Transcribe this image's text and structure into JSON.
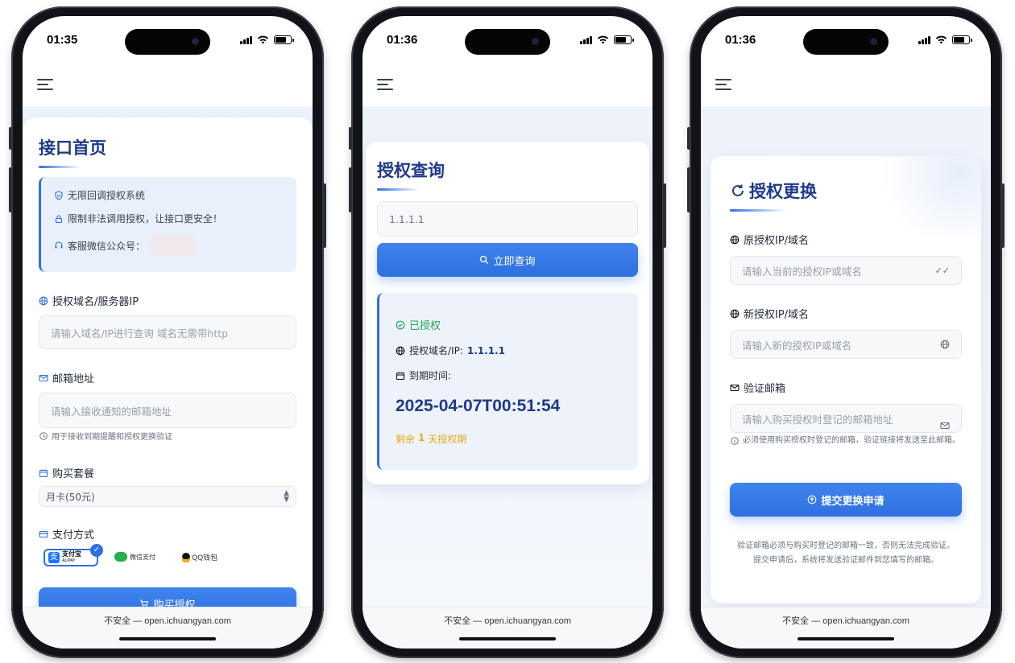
{
  "phones": [
    {
      "time": "01:35",
      "url": "不安全 — open.ichuangyan.com",
      "title": "接口首页",
      "notice": [
        "无限回调授权系统",
        "限制非法调用授权，让接口更安全！",
        "客服微信公众号："
      ],
      "domain_label": "授权域名/服务器IP",
      "domain_placeholder": "请输入域名/IP进行查询 域名无需带http",
      "email_label": "邮箱地址",
      "email_placeholder": "请输入接收通知的邮箱地址",
      "email_hint": "用于接收到期提醒和授权更换验证",
      "plan_label": "购买套餐",
      "plan_value": "月卡(50元)",
      "pay_label": "支付方式",
      "pay_options": [
        "支付宝",
        "微信支付",
        "QQ钱包"
      ],
      "alipay_en": "ALIPAY",
      "buy_button": "购买授权"
    },
    {
      "time": "01:36",
      "url": "不安全 — open.ichuangyan.com",
      "title": "授权查询",
      "query_value": "1.1.1.1",
      "query_button": "立即查询",
      "status": "已授权",
      "domain_label": "授权域名/IP:",
      "domain_value": "1.1.1.1",
      "expire_label": "到期时间:",
      "expire_value": "2025-04-07T00:51:54",
      "remain_prefix": "剩余",
      "remain_days": "1",
      "remain_suffix": "天授权期"
    },
    {
      "time": "01:36",
      "url": "不安全 — open.ichuangyan.com",
      "title": "授权更换",
      "old_label": "原授权IP/域名",
      "old_placeholder": "请输入当前的授权IP或域名",
      "new_label": "新授权IP/域名",
      "new_placeholder": "请输入新的授权IP或域名",
      "verify_label": "验证邮箱",
      "verify_placeholder": "请输入购买授权时登记的邮箱地址",
      "verify_hint": "必须使用购买授权时登记的邮箱，验证链接将发送至此邮箱。",
      "submit_button": "提交更换申请",
      "footer_note_1": "验证邮箱必须与购买时登记的邮箱一致，否则无法完成验证。",
      "footer_note_2": "提交申请后，系统将发送验证邮件到您填写的邮箱。"
    }
  ],
  "colors": {
    "primary": "#2f6fe0",
    "title": "#1e3a8a",
    "success": "#22a55a",
    "warning": "#e6a817"
  }
}
